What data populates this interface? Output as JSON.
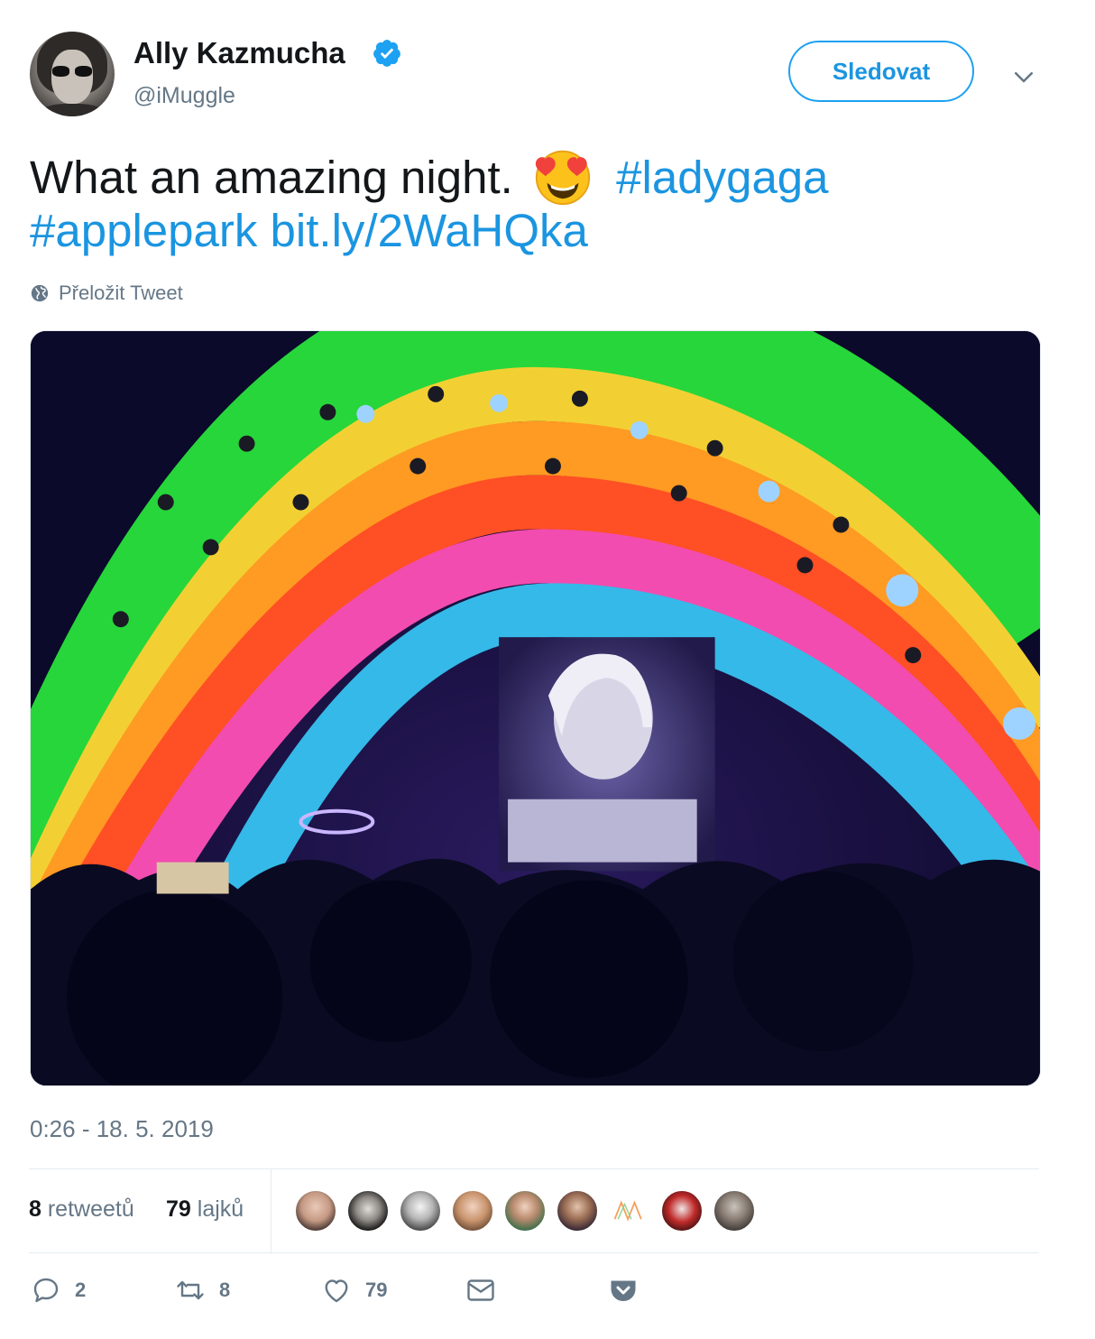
{
  "author": {
    "display_name": "Ally Kazmucha",
    "handle": "@iMuggle",
    "verified_icon": "verified-badge-icon",
    "avatar": "profile-avatar"
  },
  "header": {
    "follow_label": "Sledovat",
    "menu_icon": "chevron-down-icon"
  },
  "tweet": {
    "text": "What an amazing night.",
    "emoji": "heart-eyes-emoji",
    "hashtag1": "#ladygaga",
    "hashtag2": "#applepark",
    "link": "bit.ly/2WaHQka",
    "translate_label": "Přeložit Tweet",
    "translate_icon": "globe-icon"
  },
  "media": {
    "description_icon": "concert-photo"
  },
  "meta": {
    "timestamp": "0:26 - 18. 5. 2019"
  },
  "stats": {
    "retweets_count": "8",
    "retweets_label": "retweetů",
    "likes_count": "79",
    "likes_label": "lajků",
    "liker_count_shown": 9
  },
  "actions": {
    "reply_count": "2",
    "retweet_count": "8",
    "like_count": "79",
    "reply_icon": "reply-icon",
    "retweet_icon": "retweet-icon",
    "like_icon": "heart-icon",
    "dm_icon": "envelope-icon",
    "pocket_icon": "pocket-icon"
  },
  "colors": {
    "accent": "#1da1f2",
    "link": "#1b95e0",
    "muted": "#657786",
    "text": "#14171a"
  }
}
